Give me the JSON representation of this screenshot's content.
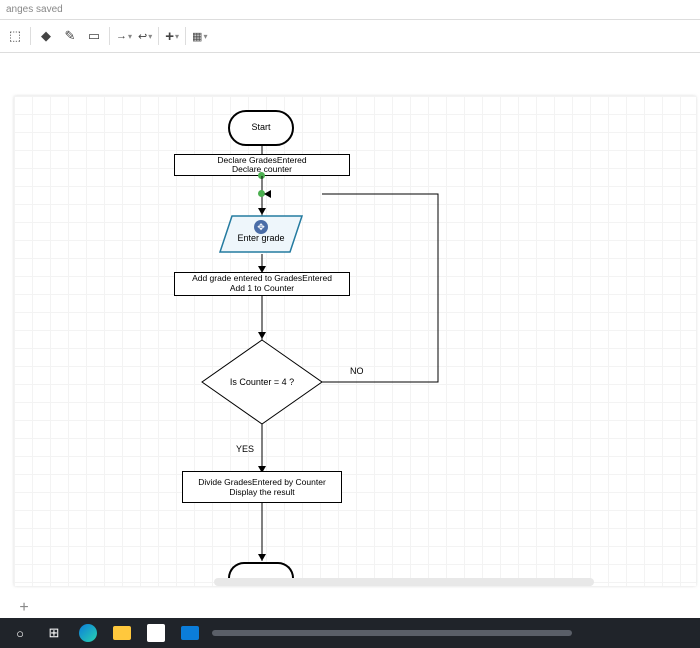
{
  "status": {
    "text": "anges saved"
  },
  "toolbar": {
    "icons": [
      "cursor",
      "paint",
      "pencil",
      "rect",
      "arrow",
      "connector",
      "plus",
      "table"
    ]
  },
  "flowchart": {
    "start": "Start",
    "declare_line1": "Declare GradesEntered",
    "declare_line2": "Declare counter",
    "input": "Enter grade",
    "process_line1": "Add grade entered to GradesEntered",
    "process_line2": "Add 1 to Counter",
    "decision": "Is Counter = 4 ?",
    "no_label": "NO",
    "yes_label": "YES",
    "result_line1": "Divide GradesEntered by Counter",
    "result_line2": "Display the result"
  },
  "footer": {
    "add": "+"
  }
}
